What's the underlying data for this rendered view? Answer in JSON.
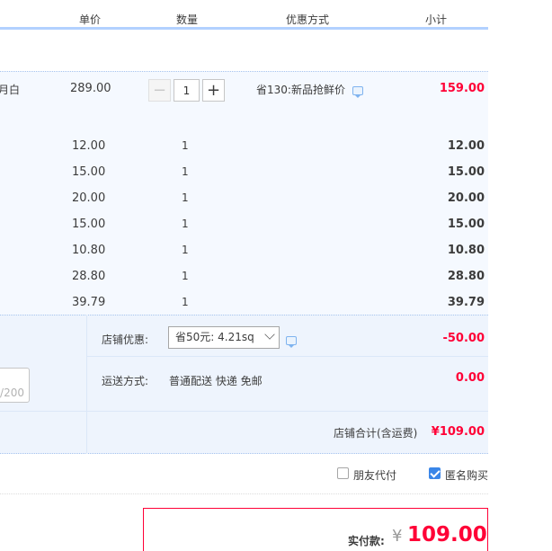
{
  "header": {
    "col_price": "单价",
    "col_qty": "数量",
    "col_discount": "优惠方式",
    "col_subtotal": "小计"
  },
  "main_item": {
    "name_fragment": "月白",
    "price": "289.00",
    "qty": "1",
    "discount_label": "省130:新品抢鲜价",
    "subtotal": "159.00"
  },
  "items": [
    {
      "price": "12.00",
      "qty": "1",
      "subtotal": "12.00"
    },
    {
      "price": "15.00",
      "qty": "1",
      "subtotal": "15.00"
    },
    {
      "price": "20.00",
      "qty": "1",
      "subtotal": "20.00"
    },
    {
      "price": "15.00",
      "qty": "1",
      "subtotal": "15.00"
    },
    {
      "price": "10.80",
      "qty": "1",
      "subtotal": "10.80"
    },
    {
      "price": "28.80",
      "qty": "1",
      "subtotal": "28.80"
    },
    {
      "price": "39.79",
      "qty": "1",
      "subtotal": "39.79"
    }
  ],
  "shop_promo": {
    "label": "店铺优惠:",
    "selected": "省50元: 4.21sq",
    "amount": "-50.00"
  },
  "message": {
    "counter": "/200"
  },
  "shipping": {
    "label": "运送方式:",
    "method": "普通配送 快递 免邮",
    "amount": "0.00"
  },
  "shop_total": {
    "label": "店铺合计(含运费)",
    "amount": "¥109.00"
  },
  "options": {
    "friend_pay": "朋友代付",
    "anonymous": "匿名购买",
    "friend_pay_checked": false,
    "anonymous_checked": true
  },
  "payment": {
    "label": "实付款:",
    "currency": "¥",
    "amount": "109.00"
  },
  "colors": {
    "accent_red": "#ff0036",
    "accent_blue": "#3a86e8",
    "band_bg": "#f5f9ff"
  }
}
